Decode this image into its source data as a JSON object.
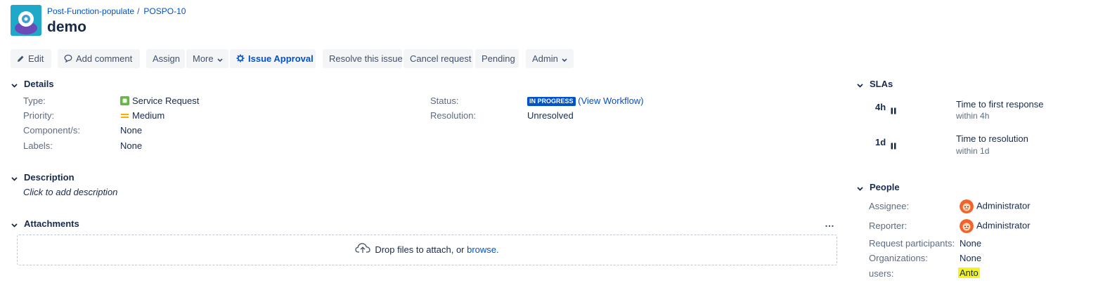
{
  "header": {
    "project_name": "Post-Function-populate",
    "issue_key": "POSPO-10",
    "summary": "demo"
  },
  "toolbar": {
    "edit": "Edit",
    "add_comment": "Add comment",
    "assign": "Assign",
    "more": "More",
    "issue_approval": "Issue Approval",
    "resolve": "Resolve this issue",
    "cancel": "Cancel request",
    "pending": "Pending",
    "admin": "Admin"
  },
  "details": {
    "heading": "Details",
    "type_label": "Type:",
    "type_value": "Service Request",
    "priority_label": "Priority:",
    "priority_value": "Medium",
    "components_label": "Component/s:",
    "components_value": "None",
    "labels_label": "Labels:",
    "labels_value": "None",
    "status_label": "Status:",
    "status_value": "IN PROGRESS",
    "view_workflow": "(View Workflow)",
    "resolution_label": "Resolution:",
    "resolution_value": "Unresolved"
  },
  "description": {
    "heading": "Description",
    "placeholder": "Click to add description"
  },
  "attachments": {
    "heading": "Attachments",
    "more": "…",
    "drop_text": "Drop files to attach, or",
    "browse": "browse."
  },
  "slas": {
    "heading": "SLAs",
    "items": [
      {
        "time": "4h",
        "title": "Time to first response",
        "sub": "within 4h"
      },
      {
        "time": "1d",
        "title": "Time to resolution",
        "sub": "within 1d"
      }
    ]
  },
  "people": {
    "heading": "People",
    "assignee_label": "Assignee:",
    "assignee_value": "Administrator",
    "reporter_label": "Reporter:",
    "reporter_value": "Administrator",
    "participants_label": "Request participants:",
    "participants_value": "None",
    "organizations_label": "Organizations:",
    "organizations_value": "None",
    "users_label": "users:",
    "users_value": "Anto"
  },
  "colors": {
    "link": "#0052cc",
    "lozenge": "#0052cc",
    "button_bg": "#f4f5f7",
    "highlight": "#f5f21c"
  }
}
